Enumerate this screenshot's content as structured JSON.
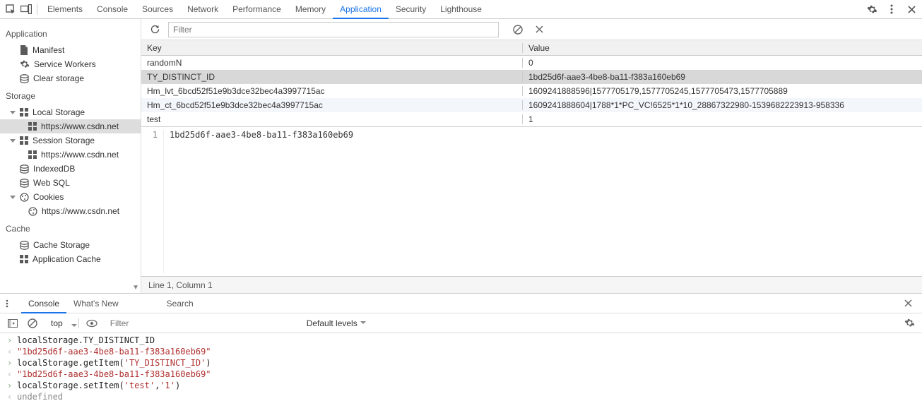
{
  "main_tabs": [
    "Elements",
    "Console",
    "Sources",
    "Network",
    "Performance",
    "Memory",
    "Application",
    "Security",
    "Lighthouse"
  ],
  "main_active": "Application",
  "sidebar": {
    "groups": [
      {
        "title": "Application",
        "items": [
          {
            "label": "Manifest",
            "icon": "file"
          },
          {
            "label": "Service Workers",
            "icon": "gear"
          },
          {
            "label": "Clear storage",
            "icon": "db"
          }
        ]
      },
      {
        "title": "Storage",
        "items": [
          {
            "label": "Local Storage",
            "icon": "grid",
            "expanded": true,
            "children": [
              {
                "label": "https://www.csdn.net",
                "icon": "grid",
                "selected": true
              }
            ]
          },
          {
            "label": "Session Storage",
            "icon": "grid",
            "expanded": true,
            "children": [
              {
                "label": "https://www.csdn.net",
                "icon": "grid"
              }
            ]
          },
          {
            "label": "IndexedDB",
            "icon": "db"
          },
          {
            "label": "Web SQL",
            "icon": "db"
          },
          {
            "label": "Cookies",
            "icon": "cookie",
            "expanded": true,
            "children": [
              {
                "label": "https://www.csdn.net",
                "icon": "cookie"
              }
            ]
          }
        ]
      },
      {
        "title": "Cache",
        "items": [
          {
            "label": "Cache Storage",
            "icon": "db"
          },
          {
            "label": "Application Cache",
            "icon": "grid"
          }
        ]
      }
    ]
  },
  "filter_placeholder": "Filter",
  "table": {
    "headers": {
      "key": "Key",
      "value": "Value"
    },
    "rows": [
      {
        "key": "randomN",
        "value": "0"
      },
      {
        "key": "TY_DISTINCT_ID",
        "value": "1bd25d6f-aae3-4be8-ba11-f383a160eb69",
        "selected": true
      },
      {
        "key": "Hm_lvt_6bcd52f51e9b3dce32bec4a3997715ac",
        "value": "1609241888596|1577705179,1577705245,1577705473,1577705889"
      },
      {
        "key": "Hm_ct_6bcd52f51e9b3dce32bec4a3997715ac",
        "value": "1609241888604|1788*1*PC_VC!6525*1*10_28867322980-1539682223913-958336"
      },
      {
        "key": "test",
        "value": "1"
      }
    ]
  },
  "preview": {
    "lineno": "1",
    "text": "1bd25d6f-aae3-4be8-ba11-f383a160eb69"
  },
  "status": "Line 1, Column 1",
  "drawer": {
    "tabs": [
      "Console",
      "What's New",
      "Search"
    ],
    "active": "Console",
    "context": "top",
    "filter_placeholder": "Filter",
    "levels": "Default levels"
  },
  "console_lines": [
    {
      "dir": "in",
      "parts": [
        {
          "t": "code",
          "v": "localStorage.TY_DISTINCT_ID"
        }
      ]
    },
    {
      "dir": "out",
      "parts": [
        {
          "t": "str",
          "v": "\"1bd25d6f-aae3-4be8-ba11-f383a160eb69\""
        }
      ]
    },
    {
      "dir": "in",
      "parts": [
        {
          "t": "code",
          "v": "localStorage.getItem("
        },
        {
          "t": "str",
          "v": "'TY_DISTINCT_ID'"
        },
        {
          "t": "code",
          "v": ")"
        }
      ]
    },
    {
      "dir": "out",
      "parts": [
        {
          "t": "str",
          "v": "\"1bd25d6f-aae3-4be8-ba11-f383a160eb69\""
        }
      ]
    },
    {
      "dir": "in",
      "parts": [
        {
          "t": "code",
          "v": "localStorage.setItem("
        },
        {
          "t": "str",
          "v": "'test'"
        },
        {
          "t": "code",
          "v": ","
        },
        {
          "t": "str",
          "v": "'1'"
        },
        {
          "t": "code",
          "v": ")"
        }
      ]
    },
    {
      "dir": "out",
      "parts": [
        {
          "t": "undef",
          "v": "undefined"
        }
      ]
    }
  ]
}
